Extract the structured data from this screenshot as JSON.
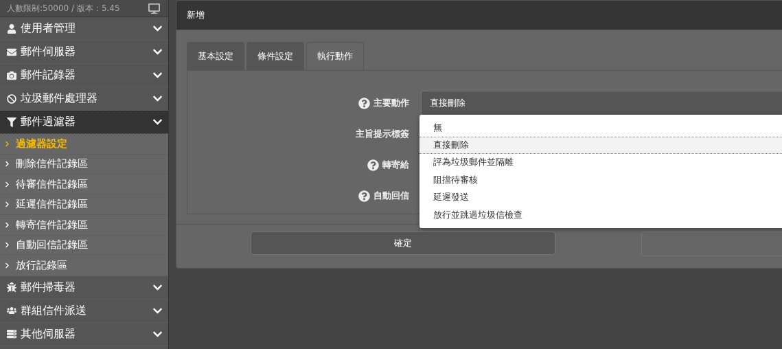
{
  "sidebar": {
    "info": "人數限制:50000 / 版本：5.45",
    "items": [
      {
        "label": "使用者管理",
        "expanded": false
      },
      {
        "label": "郵件伺服器",
        "expanded": false
      },
      {
        "label": "郵件記錄器",
        "expanded": false
      },
      {
        "label": "垃圾郵件處理器",
        "expanded": false
      },
      {
        "label": "郵件過濾器",
        "expanded": true,
        "children": [
          {
            "label": "過濾器設定",
            "selected": true
          },
          {
            "label": "刪除信件記錄區",
            "selected": false
          },
          {
            "label": "待審信件記錄區",
            "selected": false
          },
          {
            "label": "延遲信件記錄區",
            "selected": false
          },
          {
            "label": "轉寄信件記錄區",
            "selected": false
          },
          {
            "label": "自動回信記錄區",
            "selected": false
          },
          {
            "label": "放行記錄區",
            "selected": false
          }
        ]
      },
      {
        "label": "郵件掃毒器",
        "expanded": false
      },
      {
        "label": "群組信件派送",
        "expanded": false
      },
      {
        "label": "其他伺服器",
        "expanded": false
      }
    ]
  },
  "dialog": {
    "title": "新增",
    "tabs": [
      {
        "label": "基本設定",
        "selected": false
      },
      {
        "label": "條件設定",
        "selected": false
      },
      {
        "label": "執行動作",
        "selected": true
      }
    ],
    "fields": [
      {
        "label": "主要動作",
        "help": true,
        "value": "直接刪除"
      },
      {
        "label": "主旨提示標簽",
        "help": false
      },
      {
        "label": "轉寄給",
        "help": true
      },
      {
        "label": "自動回信",
        "help": true
      }
    ],
    "dropdown": [
      {
        "label": "無",
        "selected": false
      },
      {
        "label": "直接刪除",
        "selected": true
      },
      {
        "label": "評為垃圾郵件並隔離",
        "selected": false
      },
      {
        "label": "阻擋待審核",
        "selected": false
      },
      {
        "label": "延遲發送",
        "selected": false
      },
      {
        "label": "放行並跳過垃圾信檢查",
        "selected": false
      }
    ],
    "buttons": [
      "確定"
    ]
  }
}
